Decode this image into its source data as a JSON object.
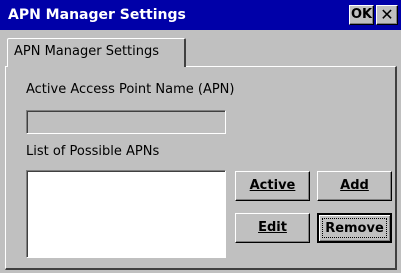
{
  "window": {
    "title": "APN Manager Settings",
    "ok_label": "OK",
    "close_glyph": "✕",
    "title_bar_color": "#0000a8"
  },
  "tabs": [
    {
      "label": "APN Manager Settings",
      "selected": true
    }
  ],
  "form": {
    "active_apn_label": "Active Access Point Name (APN)",
    "active_apn_value": "",
    "list_label": "List of Possible APNs",
    "list_items": []
  },
  "buttons": {
    "active": "Active",
    "add": "Add",
    "edit": "Edit",
    "remove": "Remove"
  }
}
